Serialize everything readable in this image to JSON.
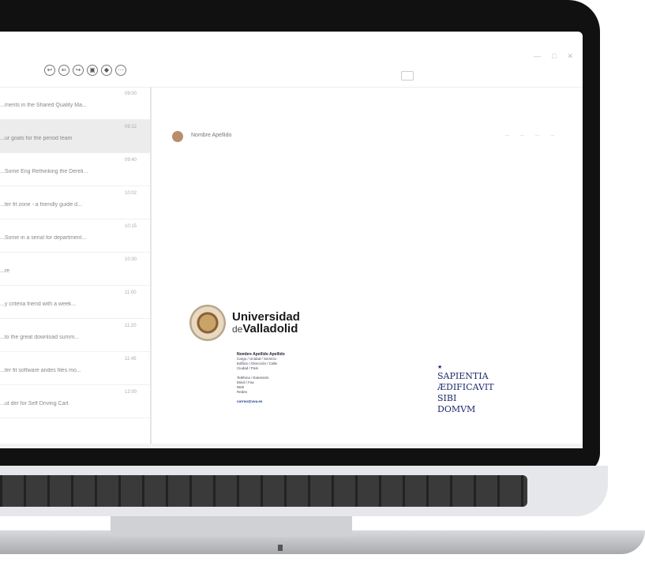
{
  "toolbar": {
    "icons": [
      "reply-icon",
      "reply-all-icon",
      "forward-icon",
      "archive-icon",
      "tag-icon",
      "more-icon"
    ]
  },
  "window": {
    "controls": [
      "minimize",
      "maximize",
      "close"
    ]
  },
  "mail_list": {
    "items": [
      {
        "subject": "...ments in the Shared Quality Ma...",
        "time": "09:00",
        "selected": false
      },
      {
        "subject": "...ur goals for the period team",
        "time": "09:12",
        "selected": true
      },
      {
        "subject": "...Some Eng Rethinking the Dereli...",
        "time": "09:40",
        "selected": false
      },
      {
        "subject": "...ter fit zone - a friendly guide d...",
        "time": "10:02",
        "selected": false
      },
      {
        "subject": "...Some in a serial for department...",
        "time": "10:15",
        "selected": false
      },
      {
        "subject": "...re",
        "time": "10:30",
        "selected": false
      },
      {
        "subject": "...y criteria friend with a week...",
        "time": "11:00",
        "selected": false
      },
      {
        "subject": "...to the great download summ...",
        "time": "11:20",
        "selected": false
      },
      {
        "subject": "...ter fit software andes files mo...",
        "time": "11:45",
        "selected": false
      },
      {
        "subject": "...ut der for Self Driving Cart",
        "time": "12:00",
        "selected": false
      }
    ]
  },
  "reading": {
    "sender": "Nombre Apellido",
    "actions": [
      "...",
      "...",
      "...",
      "..."
    ]
  },
  "signature": {
    "university_line1": "Universidad",
    "university_de": "de",
    "university_line2": "Valladolid",
    "name": "Nombre Apellido Apellido",
    "lines": [
      "Cargo / Unidad / Servicio",
      "Edificio / Dirección / Calle",
      "Ciudad / País"
    ],
    "lines2": [
      "Teléfono / Extensión",
      "Móvil / Fax",
      "Web",
      "Redes"
    ],
    "email": "correo@uva.es"
  },
  "motto": {
    "star": "★",
    "lines": [
      "SAPIENTIA",
      "ÆDIFICAVIT",
      "SIBI",
      "DOMVM"
    ]
  },
  "colors": {
    "bezel": "#111111",
    "accent_navy": "#1c2b6e",
    "selected_row": "#ececec"
  }
}
